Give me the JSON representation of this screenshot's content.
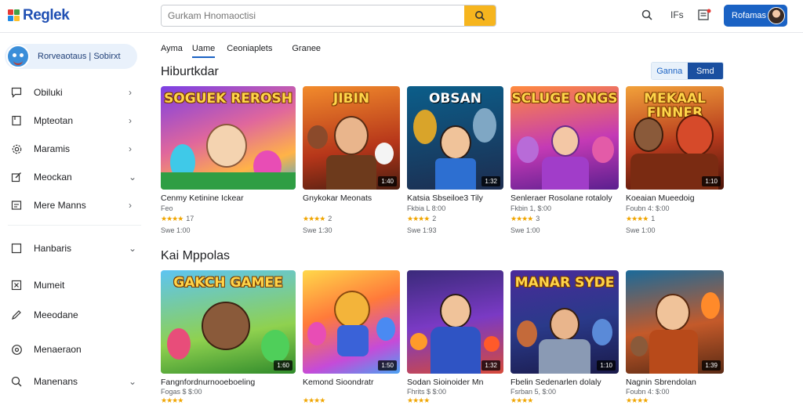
{
  "header": {
    "logo_text": "Reglek",
    "search_placeholder": "Gurkam Hnomaoctisi",
    "icons": [
      "search-icon",
      "help-icon",
      "notifications-icon"
    ],
    "help_label": "IFs",
    "user_label": "Rofamas"
  },
  "sidebar": {
    "profile_name": "Rorveaotaus | Sobirxt",
    "items": [
      {
        "label": "Obiluki",
        "icon": "message-icon",
        "chevron": "›"
      },
      {
        "label": "Mpteotan",
        "icon": "bookmark-icon",
        "chevron": "›"
      },
      {
        "label": "Maramis",
        "icon": "gear-icon",
        "chevron": "›"
      },
      {
        "label": "Meockan",
        "icon": "edit-icon",
        "chevron": "⌄"
      },
      {
        "label": "Mere Manns",
        "icon": "list-icon",
        "chevron": "›"
      },
      {
        "label": "Hanbaris",
        "icon": "square-icon",
        "chevron": "⌄"
      },
      {
        "label": "Mumeit",
        "icon": "x-box-icon",
        "chevron": ""
      },
      {
        "label": "Meeodane",
        "icon": "pencil-icon",
        "chevron": ""
      },
      {
        "label": "Menaeraon",
        "icon": "globe-icon",
        "chevron": ""
      },
      {
        "label": "Manenans",
        "icon": "search-icon",
        "chevron": "⌄"
      }
    ]
  },
  "tabs": [
    {
      "label": "Ayma",
      "active": false
    },
    {
      "label": "Uame",
      "active": true
    },
    {
      "label": "Ceoniaplets",
      "active": false
    },
    {
      "label": "Granee",
      "active": false
    }
  ],
  "section1": {
    "title": "Hiburtkdar",
    "toggle": [
      "Ganna",
      "Smd"
    ],
    "cards": [
      {
        "art_title": "SOGUEK REROSH",
        "badge": "",
        "name": "Cenmy Ketinine Ickear",
        "sub": "Feo",
        "stars": "★★★★",
        "rating_count": "17",
        "price": "Swe 1:00"
      },
      {
        "art_title": "JIBIN",
        "badge": "1:40",
        "name": "Gnykokar Meonats",
        "sub": "",
        "stars": "★★★★",
        "rating_count": "2",
        "price": "Swe 1:30"
      },
      {
        "art_title": "OBSAN",
        "badge": "1:32",
        "name": "Katsia Sbseiloe3 Tily",
        "sub": "Fkbia L 8:00",
        "stars": "★★★★",
        "rating_count": "2",
        "price": "Swe 1:93"
      },
      {
        "art_title": "SCLUGE ONGS",
        "badge": "",
        "name": "Senleraer Rosolane rotaloly",
        "sub": "Fkbin 1, $:00",
        "stars": "★★★★",
        "rating_count": "3",
        "price": "Swe 1:00"
      },
      {
        "art_title": "MEKAAL FINNER",
        "badge": "1:10",
        "name": "Koeaian Mueedoig",
        "sub": "Foubn 4: $:00",
        "stars": "★★★★",
        "rating_count": "1",
        "price": "Swe 1:00"
      }
    ]
  },
  "section2": {
    "title": "Kai Mppolas",
    "cards": [
      {
        "art_title": "GAKCH GAMEE",
        "badge": "1:60",
        "name": "Fangnfordnurnooeboeling",
        "sub": "Fogas $ $:00",
        "stars": "★★★★",
        "rating_count": "",
        "price": ""
      },
      {
        "art_title": "",
        "badge": "1:50",
        "name": "Kemond Sioondratr",
        "sub": "",
        "stars": "★★★★",
        "rating_count": "",
        "price": ""
      },
      {
        "art_title": "",
        "badge": "1:32",
        "name": "Sodan Sioinoider Mn",
        "sub": "Fhrits $ $:00",
        "stars": "★★★★",
        "rating_count": "",
        "price": ""
      },
      {
        "art_title": "MANAR SYDE",
        "badge": "1:10",
        "name": "Fbelin Sedenarlen dolaly",
        "sub": "Fsrban 5, $:00",
        "stars": "★★★★",
        "rating_count": "",
        "price": ""
      },
      {
        "art_title": "",
        "badge": "1:39",
        "name": "Nagnin Sbrendolan",
        "sub": "Foubn 4: $:00",
        "stars": "★★★★",
        "rating_count": "",
        "price": ""
      }
    ]
  },
  "colors": {
    "accent": "#1a62c4",
    "search_button": "#f6b51e",
    "star": "#f0a500"
  }
}
